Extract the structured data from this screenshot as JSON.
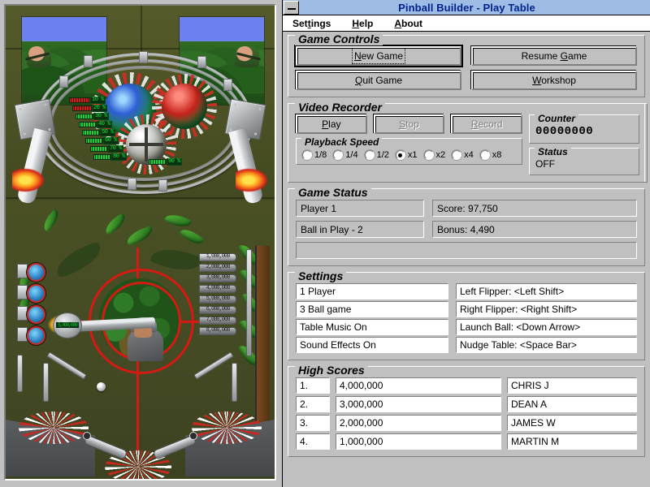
{
  "window": {
    "title": "Pinball Builder - Play Table",
    "sysmenu_icon": "minimize-icon"
  },
  "menubar": [
    {
      "label": "Settings",
      "accel": "t"
    },
    {
      "label": "Help",
      "accel": "H"
    },
    {
      "label": "About",
      "accel": "A"
    }
  ],
  "game_controls": {
    "title": "Game Controls",
    "buttons": [
      {
        "label": "New Game",
        "accel": "N",
        "state": "default-focused"
      },
      {
        "label": "Resume Game",
        "accel": "G",
        "state": "normal"
      },
      {
        "label": "Quit Game",
        "accel": "Q",
        "state": "normal"
      },
      {
        "label": "Workshop",
        "accel": "W",
        "state": "normal"
      }
    ]
  },
  "video_recorder": {
    "title": "Video Recorder",
    "buttons": [
      {
        "label": "Play",
        "accel": "P",
        "state": "normal"
      },
      {
        "label": "Stop",
        "accel": "S",
        "state": "disabled"
      },
      {
        "label": "Record",
        "accel": "R",
        "state": "disabled"
      }
    ],
    "playback_speed": {
      "title": "Playback Speed",
      "options": [
        "1/8",
        "1/4",
        "1/2",
        "x1",
        "x2",
        "x4",
        "x8"
      ],
      "selected": "x1"
    },
    "counter": {
      "title": "Counter",
      "value": "00000000"
    },
    "status": {
      "title": "Status",
      "value": "OFF"
    }
  },
  "game_status": {
    "title": "Game Status",
    "player": "Player 1",
    "score": "Score:   97,750",
    "ball": "Ball in Play - 2",
    "bonus": "Bonus:   4,490",
    "message": ""
  },
  "settings": {
    "title": "Settings",
    "left": [
      "1 Player",
      "3 Ball game",
      "Table Music On",
      "Sound Effects On"
    ],
    "right": [
      "Left Flipper:  <Left Shift>",
      "Right Flipper:  <Right Shift>",
      "Launch Ball:  <Down Arrow>",
      "Nudge Table:  <Space Bar>"
    ]
  },
  "high_scores": {
    "title": "High Scores",
    "rows": [
      {
        "rank": "1.",
        "score": "4,000,000",
        "name": "CHRIS J"
      },
      {
        "rank": "2.",
        "score": "3,000,000",
        "name": "DEAN A"
      },
      {
        "rank": "3.",
        "score": "2,000,000",
        "name": "JAMES W"
      },
      {
        "rank": "4.",
        "score": "1,000,000",
        "name": "MARTIN M"
      }
    ]
  },
  "playfield": {
    "meters": [
      "10 %",
      "20 %",
      "30 %",
      "40 %",
      "50 %",
      "60 %",
      "70 %",
      "80 %",
      "90 %"
    ],
    "score_ladder": [
      "1,000,000",
      "2,000,000",
      "3,000,000",
      "4,000,000",
      "5,000,000",
      "6,000,000",
      "7,000,000",
      "8,000,000"
    ],
    "bazooka_label": "5,000,000"
  },
  "colors": {
    "face": "#c0c0c0",
    "title_bar": "#9fbde4",
    "title_text": "#00218c",
    "shadow": "#808080",
    "highlight": "#ffffff",
    "playfield_green": "#4a5024",
    "target_red": "#d51a14"
  }
}
